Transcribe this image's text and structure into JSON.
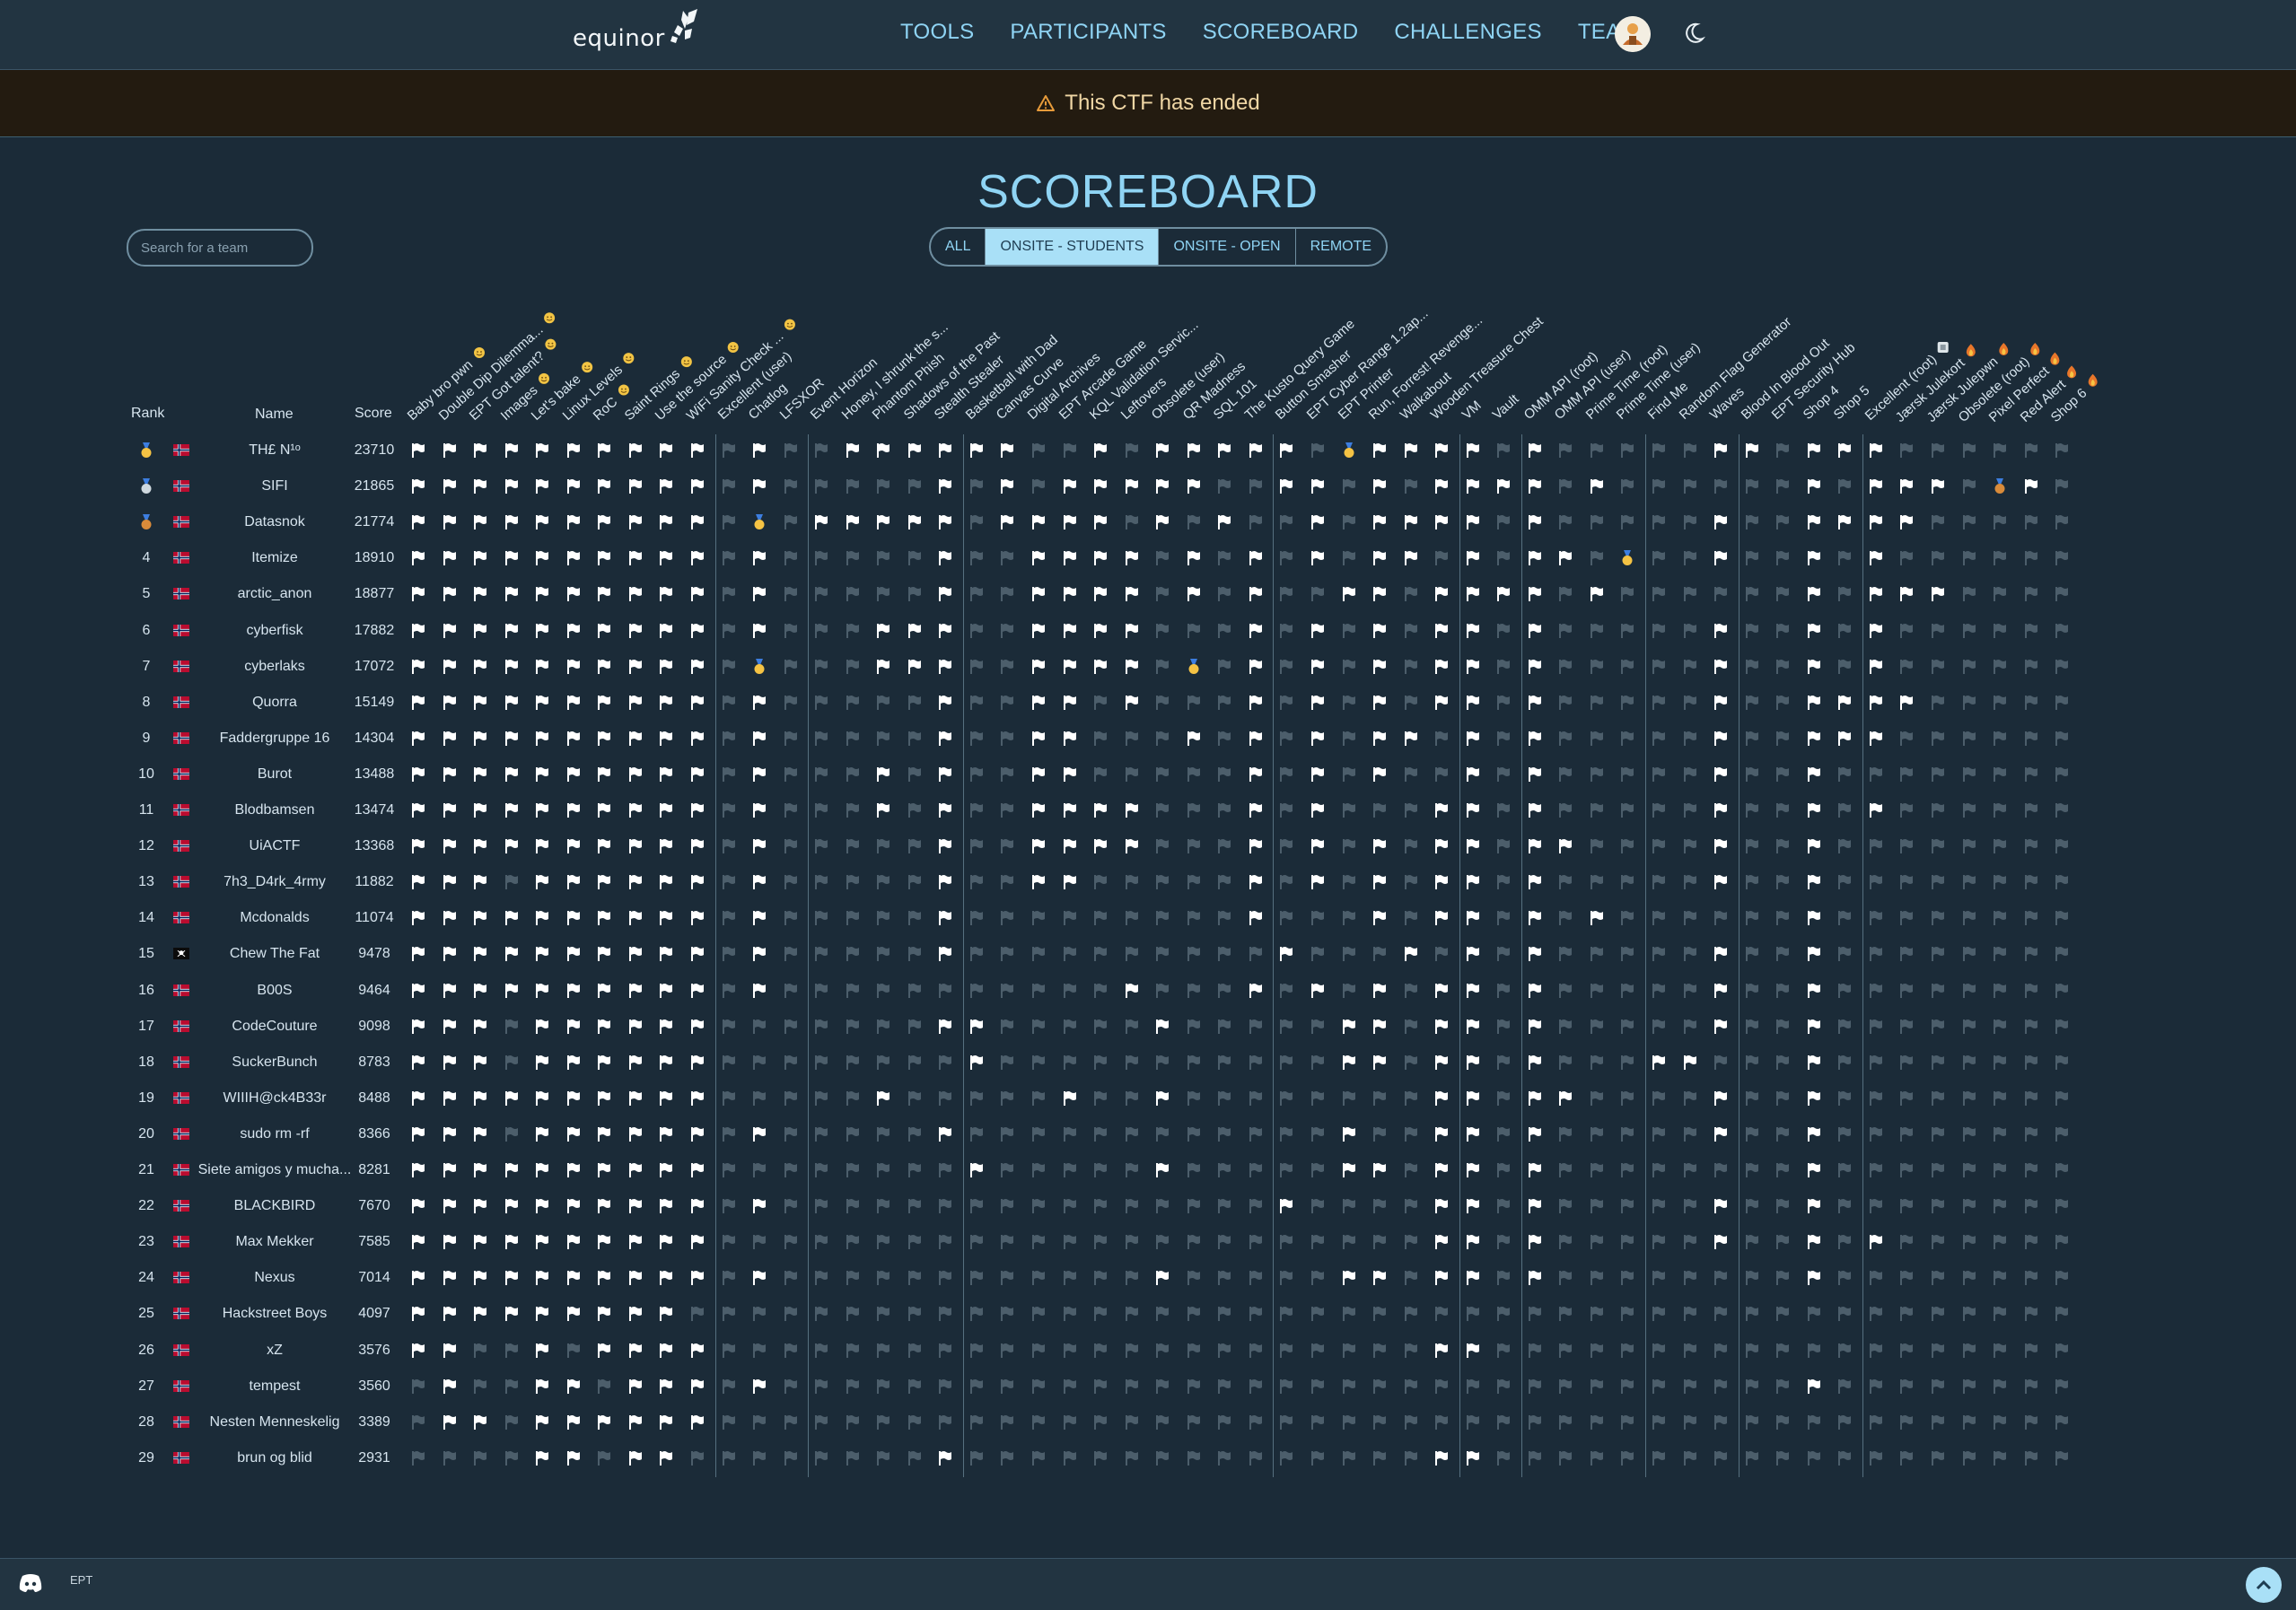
{
  "brand": "equinor",
  "nav": [
    "TOOLS",
    "PARTICIPANTS",
    "SCOREBOARD",
    "CHALLENGES",
    "TEAM"
  ],
  "banner": "This CTF has ended",
  "title": "SCOREBOARD",
  "search_placeholder": "Search for a team",
  "filters": [
    "ALL",
    "ONSITE - STUDENTS",
    "ONSITE - OPEN",
    "REMOTE"
  ],
  "active_filter": "ONSITE - STUDENTS",
  "table_headers": {
    "rank": "Rank",
    "name": "Name",
    "score": "Score"
  },
  "challenges": [
    {
      "name": "Baby bro pwn",
      "icon": "easy"
    },
    {
      "name": "Double Dip Dilemma...",
      "icon": "easy"
    },
    {
      "name": "EPT Got talent?",
      "icon": "easy"
    },
    {
      "name": "Images",
      "icon": "easy"
    },
    {
      "name": "Let's bake",
      "icon": "easy"
    },
    {
      "name": "Linux Levels",
      "icon": "easy"
    },
    {
      "name": "RoC",
      "icon": "easy"
    },
    {
      "name": "Saint Rings",
      "icon": "easy"
    },
    {
      "name": "Use the source",
      "icon": "easy"
    },
    {
      "name": "WiFi Sanity Check ...",
      "icon": "easy"
    },
    {
      "name": "Excellent (user)",
      "icon": ""
    },
    {
      "name": "Chatlog",
      "icon": ""
    },
    {
      "name": "LFSXOR",
      "icon": ""
    },
    {
      "name": "Event Horizon",
      "icon": ""
    },
    {
      "name": "Honey, I shrunk the s...",
      "icon": ""
    },
    {
      "name": "Phantom Phish",
      "icon": ""
    },
    {
      "name": "Shadows of the Past",
      "icon": ""
    },
    {
      "name": "Stealth Stealer",
      "icon": ""
    },
    {
      "name": "Basketball with Dad",
      "icon": ""
    },
    {
      "name": "Canvas Curve",
      "icon": ""
    },
    {
      "name": "Digital Archives",
      "icon": ""
    },
    {
      "name": "EPT Arcade Game",
      "icon": ""
    },
    {
      "name": "KQL Validation Servic...",
      "icon": ""
    },
    {
      "name": "Leftovers",
      "icon": ""
    },
    {
      "name": "Obsolete (user)",
      "icon": ""
    },
    {
      "name": "QR Madness",
      "icon": ""
    },
    {
      "name": "SQL 101",
      "icon": ""
    },
    {
      "name": "The Kusto Query Game",
      "icon": ""
    },
    {
      "name": "Button Smasher",
      "icon": ""
    },
    {
      "name": "EPT Cyber Range 1.2ap...",
      "icon": ""
    },
    {
      "name": "EPT Printer",
      "icon": ""
    },
    {
      "name": "Run, Forrest! Revenge...",
      "icon": ""
    },
    {
      "name": "Walkabout",
      "icon": ""
    },
    {
      "name": "Wooden Treasure Chest",
      "icon": ""
    },
    {
      "name": "VM",
      "icon": ""
    },
    {
      "name": "Vault",
      "icon": ""
    },
    {
      "name": "OMM API (root)",
      "icon": ""
    },
    {
      "name": "OMM API (user)",
      "icon": ""
    },
    {
      "name": "Prime Time (root)",
      "icon": ""
    },
    {
      "name": "Prime Time (user)",
      "icon": ""
    },
    {
      "name": "Find Me",
      "icon": ""
    },
    {
      "name": "Random Flag Generator",
      "icon": ""
    },
    {
      "name": "Waves",
      "icon": ""
    },
    {
      "name": "Blood In Blood Out",
      "icon": ""
    },
    {
      "name": "EPT Security Hub",
      "icon": ""
    },
    {
      "name": "Shop 4",
      "icon": ""
    },
    {
      "name": "Shop 5",
      "icon": ""
    },
    {
      "name": "Excellent (root)",
      "icon": "box"
    },
    {
      "name": "Jærsk Julekort",
      "icon": "hard"
    },
    {
      "name": "Jærsk Julepwn",
      "icon": "hard"
    },
    {
      "name": "Obsolete (root)",
      "icon": "hard"
    },
    {
      "name": "Pixel Perfect",
      "icon": "hard"
    },
    {
      "name": "Red Alert",
      "icon": "hard"
    },
    {
      "name": "Shop 6",
      "icon": "hard"
    }
  ],
  "teams": [
    {
      "rank": "",
      "name": "TH£ N¹ᵒ",
      "score": "23710",
      "flag": "no",
      "cells": "1111111111010011111100101111101111101000001101110000001",
      "medals": {
        "30": "gold"
      }
    },
    {
      "rank": "",
      "name": "SIFI",
      "score": "21865",
      "flag": "no",
      "cells": "1111111111010000010101111100110101111010000001011100100001",
      "medals": {
        "51": "bronze"
      }
    },
    {
      "rank": "",
      "name": "Datasnok",
      "score": "21774",
      "flag": "no",
      "cells": "1111111111010111110111101010010111101000001001111000001",
      "medals": {
        "11": "gold"
      }
    },
    {
      "rank": "4",
      "name": "Itemize",
      "score": "18910",
      "flag": "no",
      "cells": "1111111111010000010011110101010110101100001001010000001",
      "medals": {
        "39": "gold"
      }
    },
    {
      "rank": "5",
      "name": "arctic_anon",
      "score": "18877",
      "flag": "no",
      "cells": "1111111111010000010011110101001101111010000001011100001",
      "medals": {}
    },
    {
      "rank": "6",
      "name": "cyberfisk",
      "score": "17882",
      "flag": "no",
      "cells": "1111111111010001110011110001010101101000001001010000001",
      "medals": {}
    },
    {
      "rank": "7",
      "name": "cyberlaks",
      "score": "17072",
      "flag": "no",
      "cells": "1111111111010001110011110101010101101000001001010000001",
      "medals": {
        "11": "gold",
        "25": "gold"
      }
    },
    {
      "rank": "8",
      "name": "Quorra",
      "score": "15149",
      "flag": "no",
      "cells": "1111111111010000010011010001010101101000001001111000000",
      "medals": {}
    },
    {
      "rank": "9",
      "name": "Faddergruppe 16",
      "score": "14304",
      "flag": "no",
      "cells": "1111111111010000010011000101010110101000001001110000000",
      "medals": {}
    },
    {
      "rank": "10",
      "name": "Burot",
      "score": "13488",
      "flag": "no",
      "cells": "1111111111010001010011000001010100101000001001000000000",
      "medals": {}
    },
    {
      "rank": "11",
      "name": "Blodbamsen",
      "score": "13474",
      "flag": "no",
      "cells": "1111111111010001010011110001010001101000001001010000000",
      "medals": {}
    },
    {
      "rank": "12",
      "name": "UiACTF",
      "score": "13368",
      "flag": "no",
      "cells": "1111111111010000010011110001010101101100001001000000000",
      "medals": {}
    },
    {
      "rank": "13",
      "name": "7h3_D4rk_4rmy",
      "score": "11882",
      "flag": "no",
      "cells": "1110111111010000010011000001010101101000001001000000000",
      "medals": {}
    },
    {
      "rank": "14",
      "name": "Mcdonalds",
      "score": "11074",
      "flag": "no",
      "cells": "1111111111010000010000000001000101101010000001000000000",
      "medals": {}
    },
    {
      "rank": "15",
      "name": "Chew The Fat",
      "score": "9478",
      "flag": "pirate",
      "cells": "1111111111010000010000000000100010101000001001000000000",
      "medals": {}
    },
    {
      "rank": "16",
      "name": "B00S",
      "score": "9464",
      "flag": "no",
      "cells": "1111111111010000000000010001010101101000001001000000000",
      "medals": {}
    },
    {
      "rank": "17",
      "name": "CodeCouture",
      "score": "9098",
      "flag": "no",
      "cells": "1110111111000000011000001000001101101000001001000000000",
      "medals": {}
    },
    {
      "rank": "18",
      "name": "SuckerBunch",
      "score": "8783",
      "flag": "no",
      "cells": "1110111111000000001000000000001101101000110001000000000",
      "medals": {}
    },
    {
      "rank": "19",
      "name": "WIIIH@ck4B33r",
      "score": "8488",
      "flag": "no",
      "cells": "1111111111000001000001001000000001101100001001000000000",
      "medals": {}
    },
    {
      "rank": "20",
      "name": "sudo rm -rf",
      "score": "8366",
      "flag": "no",
      "cells": "1110111111010000010000000000001001101000001001000000000",
      "medals": {}
    },
    {
      "rank": "21",
      "name": "Siete amigos y mucha...",
      "score": "8281",
      "flag": "no",
      "cells": "1111111111000000001000001000001101101000000001000000000",
      "medals": {}
    },
    {
      "rank": "22",
      "name": "BLACKBIRD",
      "score": "7670",
      "flag": "no",
      "cells": "1111111111010000000000000000100001101000001001000000000",
      "medals": {}
    },
    {
      "rank": "23",
      "name": "Max Mekker",
      "score": "7585",
      "flag": "no",
      "cells": "1111111111000000000000000000000001101000001001010000000",
      "medals": {}
    },
    {
      "rank": "24",
      "name": "Nexus",
      "score": "7014",
      "flag": "no",
      "cells": "1111111111010000000000001000001101101000000001000000000",
      "medals": {}
    },
    {
      "rank": "25",
      "name": "Hackstreet Boys",
      "score": "4097",
      "flag": "no",
      "cells": "1111111110000000000000000000000000000000000000000000000",
      "medals": {}
    },
    {
      "rank": "26",
      "name": "xZ",
      "score": "3576",
      "flag": "no",
      "cells": "1100101111000000000000000000000001100000000000000000000",
      "medals": {}
    },
    {
      "rank": "27",
      "name": "tempest",
      "score": "3560",
      "flag": "no",
      "cells": "0100110111010000000000000000000000000000000001000000000",
      "medals": {}
    },
    {
      "rank": "28",
      "name": "Nesten Menneskelig",
      "score": "3389",
      "flag": "no",
      "cells": "0110111111000000000000000000000000000000000000000000000",
      "medals": {}
    },
    {
      "rank": "29",
      "name": "brun og blid",
      "score": "2931",
      "flag": "no",
      "cells": "0000110110000000010000000000000001100000000000000000000",
      "medals": {}
    }
  ],
  "top_medals": [
    "gold",
    "silver",
    "bronze"
  ],
  "footer": {
    "ept": "EPT"
  },
  "colors": {
    "accent": "#8fd4f4",
    "bg": "#1b2b38",
    "nav": "#223441",
    "banner": "#231b10",
    "warning": "#e79b3a"
  }
}
